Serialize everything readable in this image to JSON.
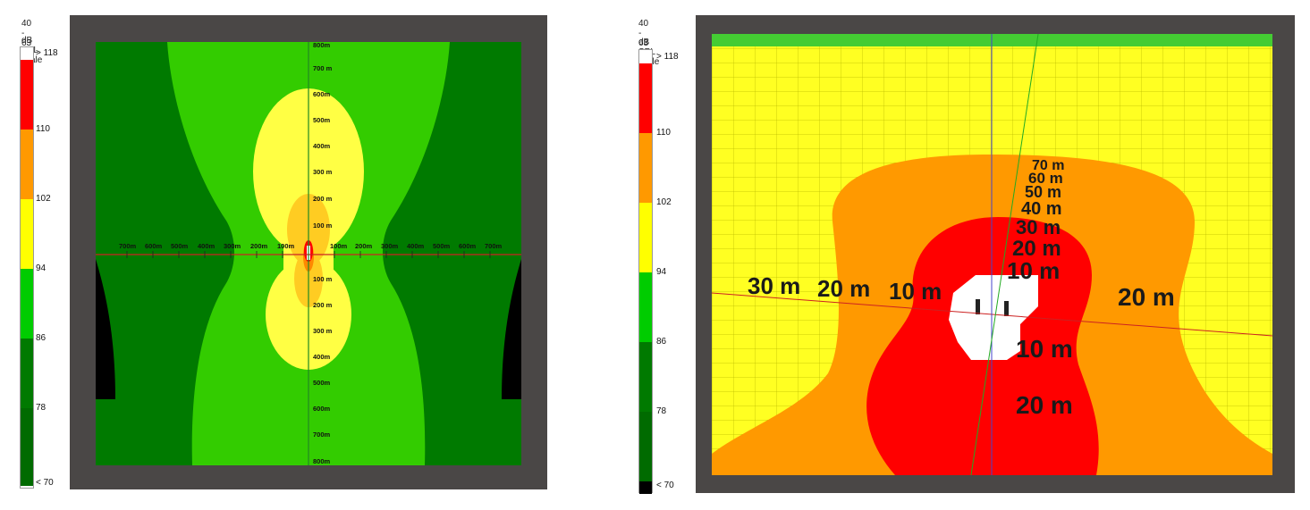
{
  "panels": [
    {
      "frequency": "40 - 63 Hz",
      "scale_title": "dB SPL scale",
      "legend_labels": [
        "> 118",
        "110",
        "102",
        "94",
        "86",
        "78",
        "< 70"
      ],
      "colors": [
        "#ffffff",
        "#ff0000",
        "#ff9900",
        "#ffff00",
        "#00cc00",
        "#007a00",
        "#000000"
      ],
      "horizontal_axis": [
        "700m",
        "600m",
        "500m",
        "400m",
        "300m",
        "200m",
        "100m",
        "100m",
        "200m",
        "300m",
        "400m",
        "500m",
        "600m",
        "700m"
      ],
      "vertical_axis_top": [
        "800m",
        "700 m",
        "600m",
        "500m",
        "400m",
        "300 m",
        "200 m",
        "100 m"
      ],
      "vertical_axis_bottom": [
        "100 m",
        "200 m",
        "300 m",
        "400m",
        "500m",
        "600m",
        "700m",
        "800m"
      ]
    },
    {
      "frequency": "40 - 63 Hz",
      "scale_title": "dB SPL scale",
      "legend_labels": [
        "> 118",
        "110",
        "102",
        "94",
        "86",
        "78",
        "< 70"
      ],
      "colors": [
        "#ffffff",
        "#ff0000",
        "#ff9900",
        "#ffff00",
        "#00cc00",
        "#007a00",
        "#000000"
      ],
      "depth_labels_top": [
        "70 m",
        "60 m",
        "50 m",
        "40 m",
        "30 m",
        "20 m",
        "10 m"
      ],
      "left_labels": [
        "30 m",
        "20 m",
        "10 m"
      ],
      "right_label": "20 m",
      "depth_labels_bottom": [
        "10 m",
        "20 m"
      ]
    }
  ]
}
